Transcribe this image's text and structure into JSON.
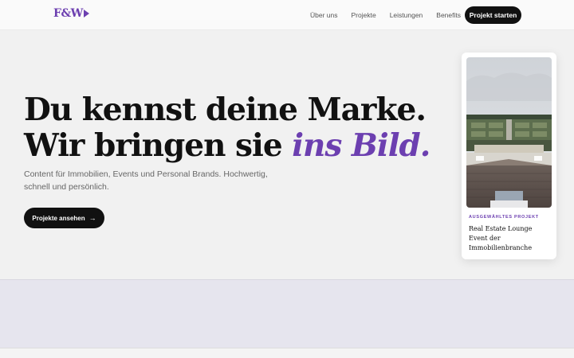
{
  "header": {
    "logo": "F&W",
    "nav": [
      "Über uns",
      "Projekte",
      "Leistungen",
      "Benefits"
    ],
    "cta": "Projekt starten"
  },
  "hero": {
    "headline_line1": "Du kennst deine Marke.",
    "headline_line2_prefix": "Wir bringen sie ",
    "headline_line2_accent": "ins Bild.",
    "subtitle": "Content für Immobilien, Events und Personal Brands. Hochwertig, schnell und persönlich.",
    "button": "Projekte ansehen"
  },
  "featured": {
    "label": "AUSGEWÄHLTES PROJEKT",
    "title_lines": [
      "Real Estate Lounge",
      "Event der",
      "Immobilienbranche"
    ]
  },
  "colors": {
    "accent": "#6c3fb0",
    "dark": "#111111",
    "background": "#f1f1f1"
  }
}
